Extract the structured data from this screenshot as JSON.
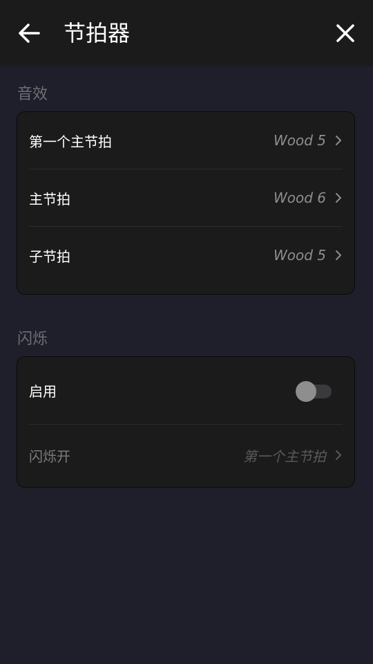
{
  "header": {
    "title": "节拍器",
    "back_icon": "arrow-left-icon",
    "close_icon": "close-icon"
  },
  "sound_section": {
    "label": "音效",
    "items": [
      {
        "label": "第一个主节拍",
        "value": "Wood 5"
      },
      {
        "label": "主节拍",
        "value": "Wood 6"
      },
      {
        "label": "子节拍",
        "value": "Wood 5"
      }
    ]
  },
  "flash_section": {
    "label": "闪烁",
    "enable": {
      "label": "启用",
      "enabled": false
    },
    "flash_on": {
      "label": "闪烁开",
      "value": "第一个主节拍"
    }
  },
  "colors": {
    "background": "#1f1f2b",
    "header": "#1b1b1b",
    "card": "#1b1b1b",
    "section_label": "#6e6e74",
    "value_text": "#8e8e93"
  }
}
